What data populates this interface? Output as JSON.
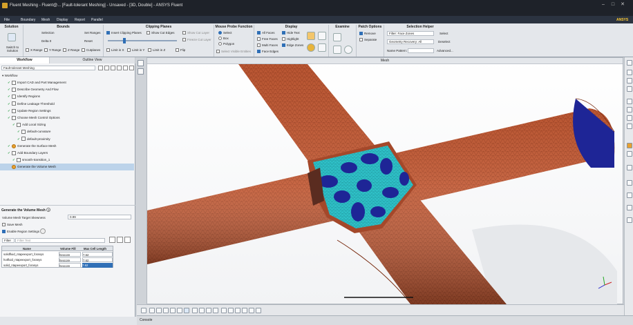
{
  "window": {
    "title": "Fluent Meshing - Fluent@... [Fault-tolerant Meshing] - Unsaved - [3D, Double] - ANSYS Fluent"
  },
  "menu": [
    "File",
    "Boundary",
    "Mesh",
    "Display",
    "Report",
    "Parallel"
  ],
  "ribbon": {
    "solution": {
      "title": "Solution",
      "switch_label": "Switch to Solution"
    },
    "bounds": {
      "title": "Bounds",
      "selection": "Selection",
      "delta_label": "Delta",
      "delta_value": "0",
      "set_ranges": "Set Ranges",
      "reset": "Reset",
      "x_range": "X Range",
      "y_range": "Y Range",
      "z_range": "Z Range",
      "cutplanes": "Cutplanes"
    },
    "clipping": {
      "title": "Clipping Planes",
      "insert": "Insert Clipping Planes",
      "show_cut_edges": "Show Cut Edges",
      "show_cut_layer": "Show Cut Layer",
      "freeze_cut_layer": "Freeze Cut Layer",
      "limit_x": "Limit in X",
      "limit_y": "Limit in Y",
      "limit_z": "Limit in Z",
      "flip": "Flip"
    },
    "probe": {
      "title": "Mouse Probe Function",
      "select": "Select",
      "box": "Box",
      "polygon": "Polygon",
      "select_visible": "Select Visible Entities"
    },
    "display": {
      "title": "Display",
      "all_faces": "All Faces",
      "free_faces": "Free Faces",
      "multi_faces": "Multi Faces",
      "face_edges": "Face Edges",
      "hide_text": "Hide Text",
      "highlight": "Highlight",
      "edge_zones": "Edge Zones"
    },
    "examine": {
      "title": "Examine"
    },
    "patch": {
      "title": "Patch Options",
      "remove": "Remove",
      "separate": "Separate"
    },
    "helper": {
      "title": "Selection Helper",
      "filter": "Filter: Face Zones",
      "select": "Select",
      "geometry": "Geometry Recovery: All",
      "deselect": "Deselect",
      "name_pattern": "Name Pattern:",
      "advanced": "Advanced..."
    }
  },
  "left": {
    "tabs": [
      "Workflow",
      "Outline View"
    ],
    "workflow_type": "Fault-tolerant Meshing",
    "workflow_root": "Workflow",
    "steps": [
      {
        "label": "Import CAD and Part Management",
        "state": "done",
        "indent": 1
      },
      {
        "label": "Describe Geometry And Flow",
        "state": "done",
        "indent": 1
      },
      {
        "label": "Identify Regions",
        "state": "done",
        "indent": 1
      },
      {
        "label": "Define Leakage Threshold",
        "state": "done",
        "indent": 1
      },
      {
        "label": "Update Region Settings",
        "state": "done",
        "indent": 1
      },
      {
        "label": "Choose Mesh Control Options",
        "state": "done",
        "indent": 1
      },
      {
        "label": "Add Local Sizing",
        "state": "done",
        "indent": 2
      },
      {
        "label": "default-curvature",
        "state": "item",
        "indent": 3
      },
      {
        "label": "default-proximity",
        "state": "item",
        "indent": 3
      },
      {
        "label": "Generate the Surface Mesh",
        "state": "done",
        "indent": 1
      },
      {
        "label": "Add Boundary Layers",
        "state": "done",
        "indent": 1
      },
      {
        "label": "smooth-transition_1",
        "state": "item",
        "indent": 2
      },
      {
        "label": "Generate the Volume Mesh",
        "state": "current",
        "indent": 1
      }
    ],
    "task": {
      "title": "Generate the Volume Mesh",
      "skewness_label": "Volume Mesh Target Skewness",
      "skewness_value": "0.99",
      "save_mesh": "Save Mesh",
      "enable_region": "Enable Region Settings",
      "filter_label": "Filter",
      "filter_placeholder": "Filter Text",
      "columns": [
        "Name",
        "Volume Fill",
        "Max Cell Length"
      ],
      "rows": [
        {
          "name": "solidfluid_ntapeexport_foranys",
          "fill": "hexcore",
          "len": "7.62"
        },
        {
          "name": "hotfluid_ntapeexport_foranys",
          "fill": "hexcore",
          "len": "7.62"
        },
        {
          "name": "solid_ntapeexport_foranys",
          "fill": "hexcore",
          "len": "7.62"
        }
      ]
    }
  },
  "viewport": {
    "title": "Mesh"
  },
  "console_label": "Console",
  "brand": "ANSYS",
  "colors": {
    "pipe": "#c25a35",
    "pipe_dark": "#8a3519",
    "cyan": "#2fc1c8",
    "navy": "#1e2596",
    "accent": "#2f6fb6"
  }
}
